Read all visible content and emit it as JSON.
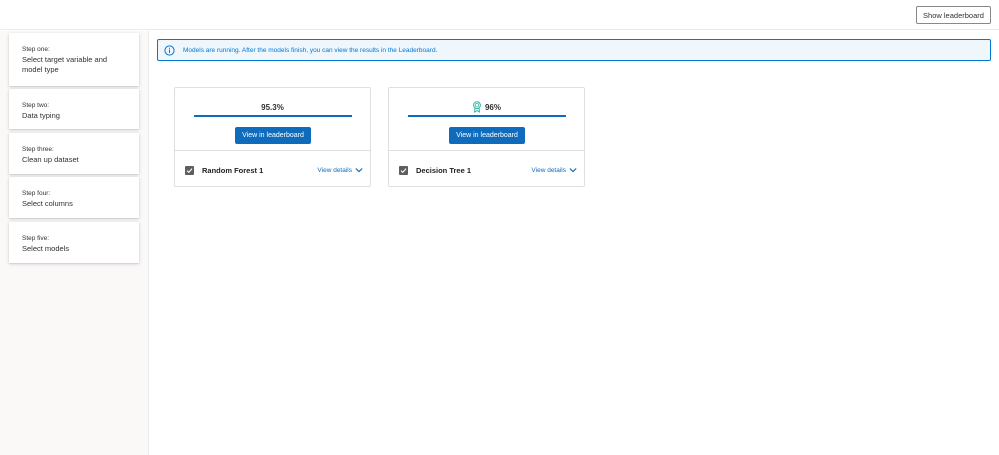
{
  "header": {
    "show_leaderboard_label": "Show leaderboard"
  },
  "sidebar": {
    "steps": [
      {
        "num": "Step one:",
        "title": "Select target variable and model type"
      },
      {
        "num": "Step two:",
        "title": "Data typing"
      },
      {
        "num": "Step three:",
        "title": "Clean up dataset"
      },
      {
        "num": "Step four:",
        "title": "Select columns"
      },
      {
        "num": "Step five:",
        "title": "Select models"
      }
    ]
  },
  "banner": {
    "icon": "info-icon",
    "text": "Models are running. After the models finish, you can view the results in the Leaderboard."
  },
  "models": [
    {
      "score": "95.3%",
      "progress": 1.0,
      "button_label": "View in leaderboard",
      "name": "Random Forest 1",
      "details_label": "View details",
      "checked": true,
      "award": false
    },
    {
      "score": "96%",
      "progress": 1.0,
      "button_label": "View in leaderboard",
      "name": "Decision Tree 1",
      "details_label": "View details",
      "checked": true,
      "award": true,
      "award_icon": "ribbon-award-icon"
    }
  ],
  "colors": {
    "accent": "#0f6cbd",
    "banner_bg": "#eff6fc",
    "award": "#2fb5a4"
  }
}
